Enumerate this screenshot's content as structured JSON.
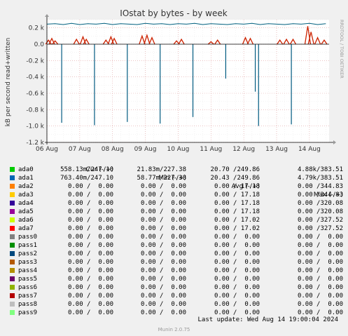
{
  "chart_data": {
    "type": "line",
    "title": "IOstat by bytes - by week",
    "ylabel": "kB per second read+written",
    "watermark": "RRDTOOL / TOBI OETIKER",
    "ylim": [
      -1200,
      300
    ],
    "yticks": [
      0.2,
      0.0,
      -0.2,
      -0.4,
      -0.6,
      -0.8,
      -1.0,
      -1.2
    ],
    "ytick_labels": [
      "0.2 k",
      "0.0",
      "-0.2 k",
      "-0.4 k",
      "-0.6 k",
      "-0.8 k",
      "-1.0 k",
      "-1.2 k"
    ],
    "xtick_labels": [
      "06 Aug",
      "07 Aug",
      "08 Aug",
      "09 Aug",
      "10 Aug",
      "11 Aug",
      "12 Aug",
      "13 Aug",
      "14 Aug"
    ],
    "x_range_days": [
      0,
      8.6
    ],
    "grid": true,
    "colors": {
      "read_line": "#005A80",
      "write_line": "#CC2200",
      "teal_series": "#00607F",
      "zero_line": "#000000",
      "grid_major": "#E0A0A0",
      "grid_minor": "#E8E8E8"
    },
    "series": [
      {
        "name": "ada0",
        "description_hidden": false,
        "write_level_k": 0.24,
        "write_points_day": [
          [
            0.0,
            0.245
          ],
          [
            0.25,
            0.25
          ],
          [
            0.5,
            0.24
          ],
          [
            0.75,
            0.255
          ],
          [
            1.0,
            0.24
          ],
          [
            1.25,
            0.25
          ],
          [
            1.5,
            0.245
          ],
          [
            1.75,
            0.255
          ],
          [
            2.0,
            0.24
          ],
          [
            2.25,
            0.25
          ],
          [
            2.5,
            0.245
          ],
          [
            2.75,
            0.24
          ],
          [
            3.0,
            0.255
          ],
          [
            3.25,
            0.245
          ],
          [
            3.5,
            0.25
          ],
          [
            3.75,
            0.24
          ],
          [
            4.0,
            0.25
          ],
          [
            4.25,
            0.245
          ],
          [
            4.5,
            0.255
          ],
          [
            4.75,
            0.24
          ],
          [
            5.0,
            0.25
          ],
          [
            5.25,
            0.245
          ],
          [
            5.5,
            0.24
          ],
          [
            5.75,
            0.25
          ],
          [
            6.0,
            0.245
          ],
          [
            6.25,
            0.255
          ],
          [
            6.5,
            0.24
          ],
          [
            6.75,
            0.25
          ],
          [
            7.0,
            0.245
          ],
          [
            7.25,
            0.24
          ],
          [
            7.5,
            0.25
          ],
          [
            7.75,
            0.245
          ],
          [
            8.0,
            0.255
          ],
          [
            8.25,
            0.24
          ],
          [
            8.5,
            0.25
          ]
        ],
        "read_spikes_day": [
          [
            0.45,
            -0.96
          ],
          [
            1.45,
            -0.99
          ],
          [
            2.45,
            -0.95
          ],
          [
            3.45,
            -0.97
          ],
          [
            4.45,
            -0.89
          ],
          [
            5.45,
            -0.42
          ],
          [
            6.35,
            -0.58
          ],
          [
            6.45,
            -1.0
          ],
          [
            7.45,
            -0.98
          ]
        ]
      },
      {
        "name": "ada1",
        "write_bursts_day": [
          [
            0.05,
            0.05
          ],
          [
            0.15,
            0.07
          ],
          [
            0.25,
            0.04
          ],
          [
            0.9,
            0.06
          ],
          [
            1.1,
            0.09
          ],
          [
            1.2,
            0.06
          ],
          [
            1.8,
            0.05
          ],
          [
            1.95,
            0.09
          ],
          [
            2.05,
            0.07
          ],
          [
            2.9,
            0.1
          ],
          [
            3.05,
            0.11
          ],
          [
            3.2,
            0.08
          ],
          [
            3.95,
            0.04
          ],
          [
            4.1,
            0.06
          ],
          [
            5.0,
            0.03
          ],
          [
            5.2,
            0.05
          ],
          [
            6.05,
            0.08
          ],
          [
            6.2,
            0.07
          ],
          [
            7.1,
            0.05
          ],
          [
            7.3,
            0.06
          ],
          [
            7.5,
            0.06
          ],
          [
            7.95,
            0.22
          ],
          [
            8.05,
            0.15
          ],
          [
            8.25,
            0.08
          ],
          [
            8.45,
            0.05
          ]
        ]
      }
    ],
    "legend": {
      "headers": [
        "Cur (-/+)",
        "Min (-/+)",
        "Avg (-/+)",
        "Max (-/+)"
      ],
      "rows": [
        {
          "name": "ada0",
          "color": "#00CC00",
          "cur": "558.13m/247.10",
          "min": "21.83m/227.38",
          "avg": "20.70 /249.86",
          "max": "4.88k/383.51"
        },
        {
          "name": "ada1",
          "color": "#0066B3",
          "cur": "763.40m/247.10",
          "min": "58.77m/227.38",
          "avg": "20.43 /249.86",
          "max": "4.79k/383.51"
        },
        {
          "name": "ada2",
          "color": "#FF8000",
          "cur": "0.00 /  0.00",
          "min": "0.00 /  0.00",
          "avg": "0.00 / 17.18",
          "max": "0.00 /344.83"
        },
        {
          "name": "ada3",
          "color": "#FFCC00",
          "cur": "0.00 /  0.00",
          "min": "0.00 /  0.00",
          "avg": "0.00 / 17.18",
          "max": "0.00 /344.83"
        },
        {
          "name": "ada4",
          "color": "#330099",
          "cur": "0.00 /  0.00",
          "min": "0.00 /  0.00",
          "avg": "0.00 / 17.18",
          "max": "0.00 /320.08"
        },
        {
          "name": "ada5",
          "color": "#990099",
          "cur": "0.00 /  0.00",
          "min": "0.00 /  0.00",
          "avg": "0.00 / 17.18",
          "max": "0.00 /320.08"
        },
        {
          "name": "ada6",
          "color": "#CCFF00",
          "cur": "0.00 /  0.00",
          "min": "0.00 /  0.00",
          "avg": "0.00 / 17.02",
          "max": "0.00 /327.52"
        },
        {
          "name": "ada7",
          "color": "#FF0000",
          "cur": "0.00 /  0.00",
          "min": "0.00 /  0.00",
          "avg": "0.00 / 17.02",
          "max": "0.00 /327.52"
        },
        {
          "name": "pass0",
          "color": "#808080",
          "cur": "0.00 /  0.00",
          "min": "0.00 /  0.00",
          "avg": "0.00 /  0.00",
          "max": "0.00 /  0.00"
        },
        {
          "name": "pass1",
          "color": "#008F00",
          "cur": "0.00 /  0.00",
          "min": "0.00 /  0.00",
          "avg": "0.00 /  0.00",
          "max": "0.00 /  0.00"
        },
        {
          "name": "pass2",
          "color": "#00487D",
          "cur": "0.00 /  0.00",
          "min": "0.00 /  0.00",
          "avg": "0.00 /  0.00",
          "max": "0.00 /  0.00"
        },
        {
          "name": "pass3",
          "color": "#B35A00",
          "cur": "0.00 /  0.00",
          "min": "0.00 /  0.00",
          "avg": "0.00 /  0.00",
          "max": "0.00 /  0.00"
        },
        {
          "name": "pass4",
          "color": "#B38F00",
          "cur": "0.00 /  0.00",
          "min": "0.00 /  0.00",
          "avg": "0.00 /  0.00",
          "max": "0.00 /  0.00"
        },
        {
          "name": "pass5",
          "color": "#6B006B",
          "cur": "0.00 /  0.00",
          "min": "0.00 /  0.00",
          "avg": "0.00 /  0.00",
          "max": "0.00 /  0.00"
        },
        {
          "name": "pass6",
          "color": "#8FB300",
          "cur": "0.00 /  0.00",
          "min": "0.00 /  0.00",
          "avg": "0.00 /  0.00",
          "max": "0.00 /  0.00"
        },
        {
          "name": "pass7",
          "color": "#B30000",
          "cur": "0.00 /  0.00",
          "min": "0.00 /  0.00",
          "avg": "0.00 /  0.00",
          "max": "0.00 /  0.00"
        },
        {
          "name": "pass8",
          "color": "#BEBEBE",
          "cur": "0.00 /  0.00",
          "min": "0.00 /  0.00",
          "avg": "0.00 /  0.00",
          "max": "0.00 /  0.00"
        },
        {
          "name": "pass9",
          "color": "#80FF80",
          "cur": "0.00 /  0.00",
          "min": "0.00 /  0.00",
          "avg": "0.00 /  0.00",
          "max": "0.00 /  0.00"
        }
      ]
    },
    "last_update": "Last update: Wed Aug 14 19:00:04 2024",
    "footer": "Munin 2.0.75"
  }
}
